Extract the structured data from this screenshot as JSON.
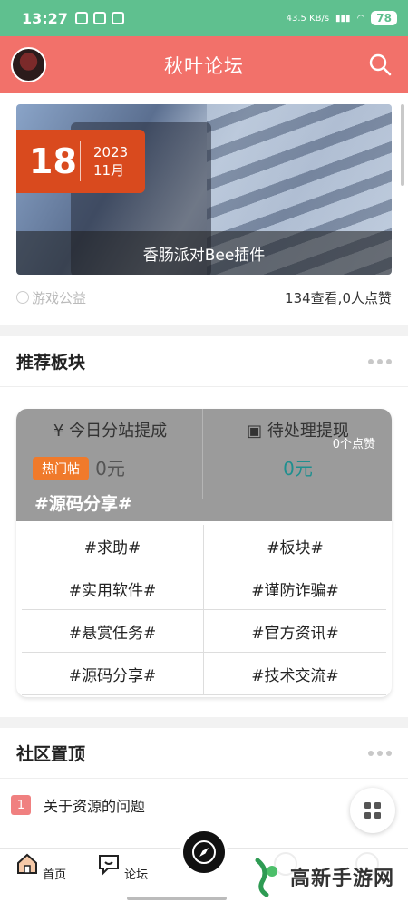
{
  "status_bar": {
    "time": "13:27",
    "net_speed": "43.5 KB/s",
    "battery": "78"
  },
  "header": {
    "title": "秋叶论坛"
  },
  "banner": {
    "day": "18",
    "year": "2023",
    "month": "11月",
    "caption": "香肠派对Bee插件"
  },
  "post_meta": {
    "category": "游戏公益",
    "stats": "134查看,0人点赞"
  },
  "recommend": {
    "title": "推荐板块",
    "stat1_label": "¥ 今日分站提成",
    "stat1_value": "0元",
    "stat2_label": "待处理提现",
    "stat2_value": "0元",
    "likes": "0个点赞",
    "hot_tag": "热门帖",
    "hot_title": "#源码分享#",
    "tags": [
      "#求助#",
      "#板块#",
      "#实用软件#",
      "#谨防诈骗#",
      "#悬赏任务#",
      "#官方资讯#",
      "#源码分享#",
      "#技术交流#"
    ]
  },
  "community_top": {
    "title": "社区置顶",
    "items": [
      {
        "rank": "1",
        "text": "关于资源的问题"
      }
    ]
  },
  "tabbar": {
    "home": "首页",
    "forum": "论坛"
  },
  "watermark": {
    "text": "高新手游网"
  },
  "colors": {
    "accent": "#f2716a",
    "status": "#5fc08f",
    "hot": "#f07a2b"
  }
}
